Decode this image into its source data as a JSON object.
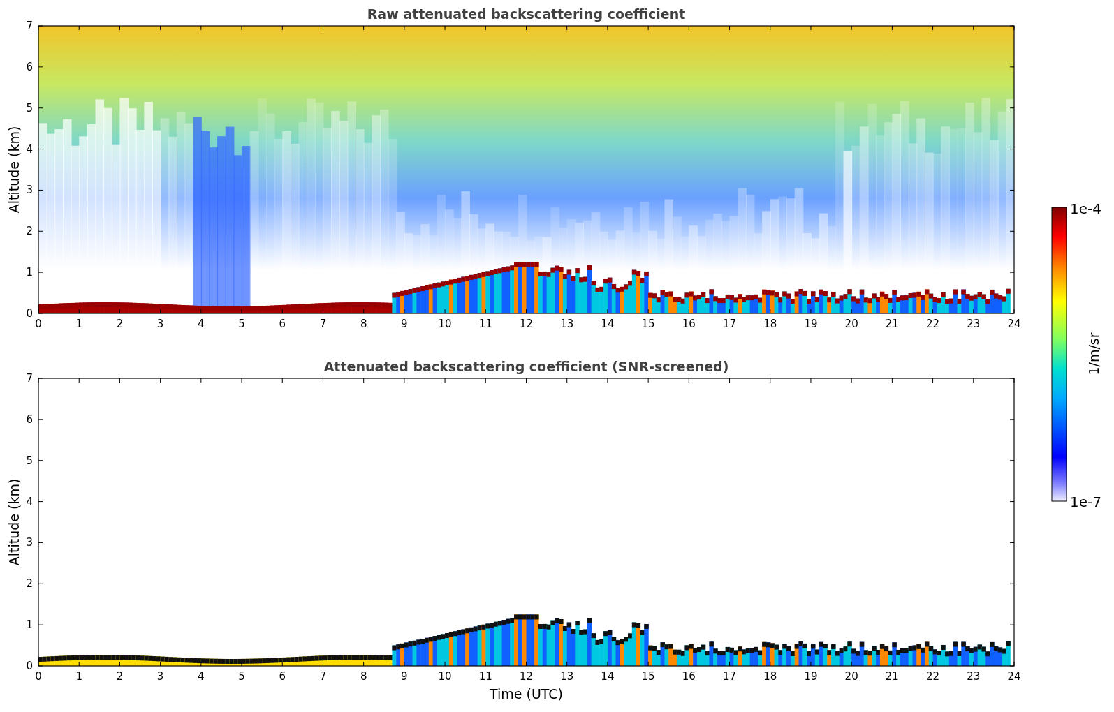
{
  "panels": [
    {
      "kind": "raw",
      "title": "Raw attenuated backscattering coefficient",
      "ylabel": "Altitude (km)",
      "yticks": [
        "7",
        "6",
        "5",
        "4",
        "3",
        "2",
        "1",
        "0"
      ],
      "xticks": [
        "0",
        "1",
        "2",
        "3",
        "4",
        "5",
        "6",
        "7",
        "8",
        "9",
        "10",
        "11",
        "12",
        "13",
        "14",
        "15",
        "16",
        "17",
        "18",
        "19",
        "20",
        "21",
        "22",
        "23",
        "24"
      ]
    },
    {
      "kind": "screened",
      "title": "Attenuated backscattering coefficient (SNR-screened)",
      "ylabel": "Altitude (km)",
      "yticks": [
        "7",
        "6",
        "5",
        "4",
        "3",
        "2",
        "1",
        "0"
      ],
      "xticks": [
        "0",
        "1",
        "2",
        "3",
        "4",
        "5",
        "6",
        "7",
        "8",
        "9",
        "10",
        "11",
        "12",
        "13",
        "14",
        "15",
        "16",
        "17",
        "18",
        "19",
        "20",
        "21",
        "22",
        "23",
        "24"
      ],
      "xlabel": "Time (UTC)"
    }
  ],
  "colorbar": {
    "max_label": "1e-4",
    "min_label": "1e-7",
    "label": "1/m/sr"
  }
}
